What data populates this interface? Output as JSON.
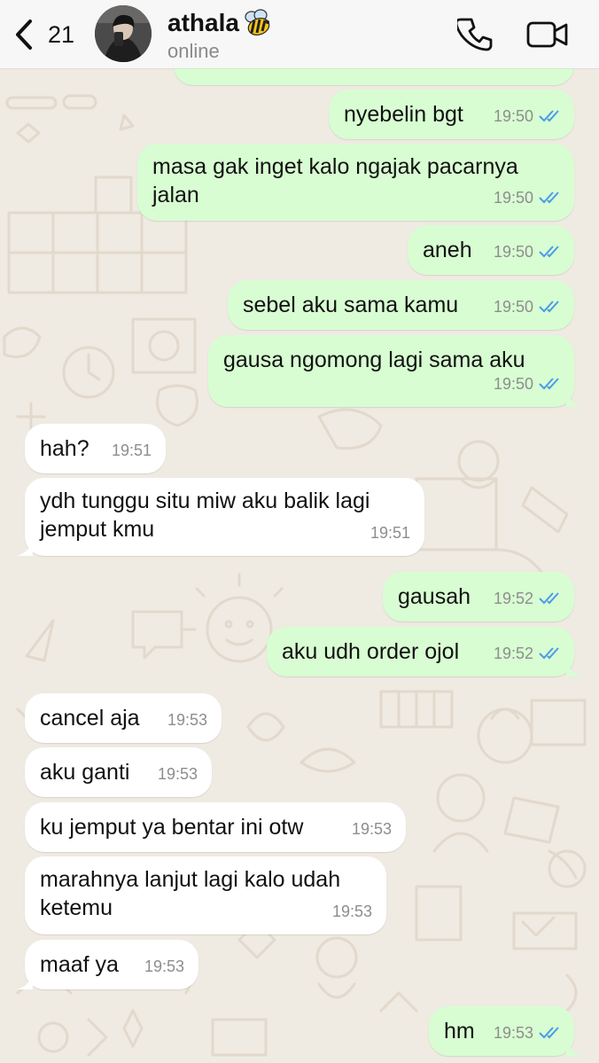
{
  "header": {
    "back_count": "21",
    "contact_name": "athala",
    "contact_status": "online"
  },
  "colors": {
    "outgoing_bubble": "#d8fdd2",
    "incoming_bubble": "#ffffff",
    "read_ticks": "#4a9ce8",
    "wallpaper": "#efeae2"
  },
  "messages": [
    {
      "dir": "out",
      "text": "",
      "time": "19:50",
      "ticks": "read"
    },
    {
      "dir": "out",
      "text": "nyebelin bgt",
      "time": "19:50",
      "ticks": "read"
    },
    {
      "dir": "out",
      "lines": [
        "masa gak inget kalo ngajak pacarnya",
        "jalan"
      ],
      "time": "19:50",
      "ticks": "read"
    },
    {
      "dir": "out",
      "text": "aneh",
      "time": "19:50",
      "ticks": "read"
    },
    {
      "dir": "out",
      "text": "sebel aku sama kamu",
      "time": "19:50",
      "ticks": "read"
    },
    {
      "dir": "out",
      "text": "gausa ngomong lagi sama aku",
      "time": "19:50",
      "ticks": "read"
    },
    {
      "dir": "in",
      "text": "hah?",
      "time": "19:51"
    },
    {
      "dir": "in",
      "lines": [
        "ydh tunggu situ miw aku balik lagi",
        "jemput kmu"
      ],
      "time": "19:51"
    },
    {
      "dir": "out",
      "text": "gausah",
      "time": "19:52",
      "ticks": "read"
    },
    {
      "dir": "out",
      "text": "aku udh order ojol",
      "time": "19:52",
      "ticks": "read"
    },
    {
      "dir": "in",
      "text": "cancel aja",
      "time": "19:53"
    },
    {
      "dir": "in",
      "text": "aku ganti",
      "time": "19:53"
    },
    {
      "dir": "in",
      "text": "ku jemput ya bentar ini otw",
      "time": "19:53"
    },
    {
      "dir": "in",
      "lines": [
        "marahnya lanjut lagi kalo udah",
        "ketemu"
      ],
      "time": "19:53"
    },
    {
      "dir": "in",
      "text": "maaf ya",
      "time": "19:53"
    },
    {
      "dir": "out",
      "text": "hm",
      "time": "19:53",
      "ticks": "read"
    }
  ]
}
